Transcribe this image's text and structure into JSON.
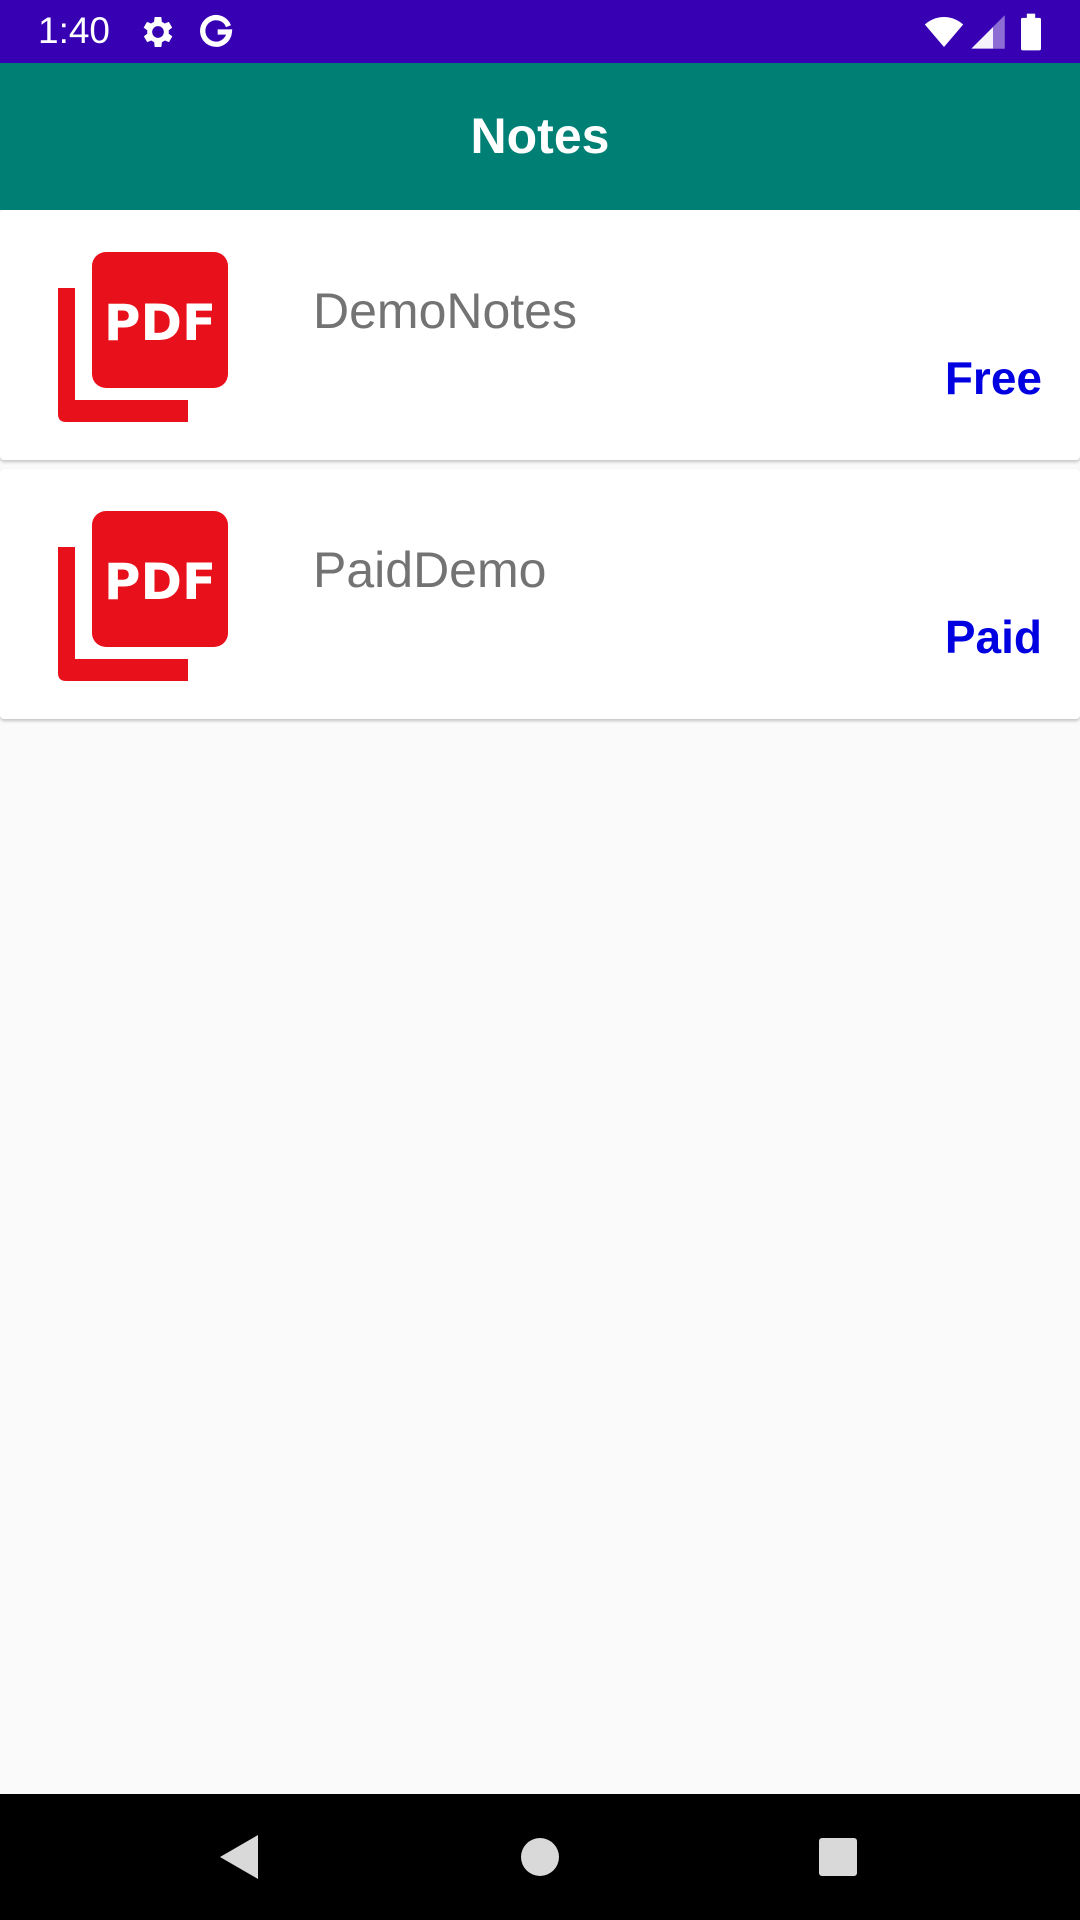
{
  "status_bar": {
    "time": "1:40",
    "icons": [
      "gear-icon",
      "google-g-icon",
      "wifi-icon",
      "signal-icon",
      "battery-icon"
    ]
  },
  "app_bar": {
    "title": "Notes",
    "color": "#008075"
  },
  "notes": [
    {
      "title": "DemoNotes",
      "price_label": "Free",
      "icon": "pdf-icon",
      "icon_text": "PDF"
    },
    {
      "title": "PaidDemo",
      "price_label": "Paid",
      "icon": "pdf-icon",
      "icon_text": "PDF"
    }
  ],
  "colors": {
    "status_bar": "#3700b3",
    "accent_pdf": "#e8101a",
    "price_text": "#0000e0",
    "title_text": "#737373"
  },
  "nav_bar": {
    "buttons": [
      "back-icon",
      "home-icon",
      "recents-icon"
    ]
  }
}
